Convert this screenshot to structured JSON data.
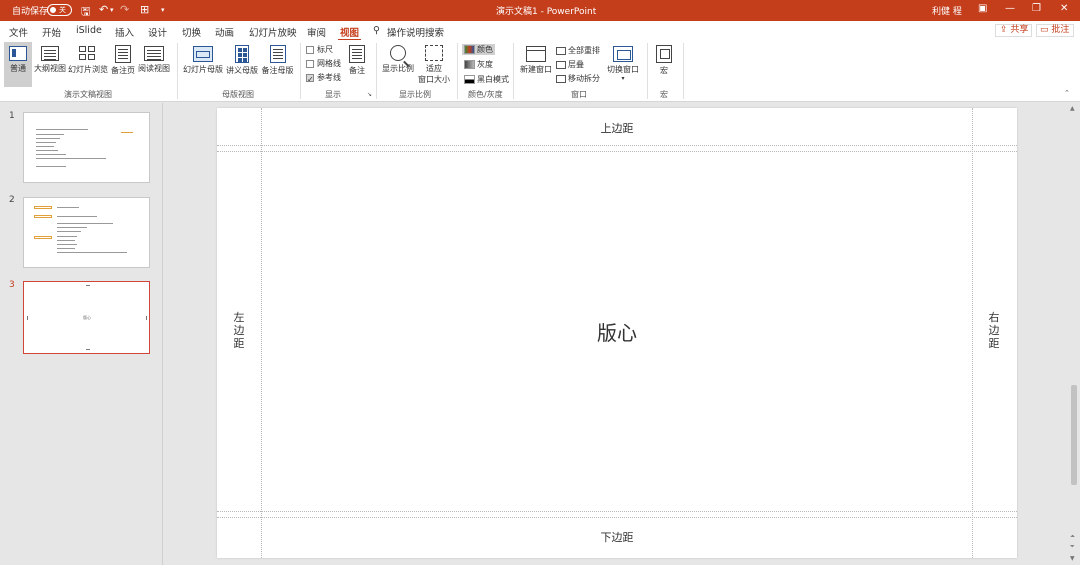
{
  "titlebar": {
    "autosave_label": "自动保存",
    "autosave_state": "关",
    "doc_title": "演示文稿1 - PowerPoint",
    "user": "利健 程",
    "color": "#c43e1c"
  },
  "menu": {
    "tabs": [
      "文件",
      "开始",
      "iSlide",
      "插入",
      "设计",
      "切换",
      "动画",
      "幻灯片放映",
      "审阅",
      "视图"
    ],
    "active_tab": "视图",
    "search_label": "操作说明搜索",
    "share_label": "共享",
    "comments_label": "批注"
  },
  "ribbon": {
    "groups": {
      "presentation_views": {
        "label": "演示文稿视图",
        "buttons": [
          "普通",
          "大纲视图",
          "幻灯片浏览",
          "备注页",
          "阅读视图"
        ]
      },
      "master_views": {
        "label": "母版视图",
        "buttons": [
          "幻灯片母版",
          "讲义母版",
          "备注母版"
        ]
      },
      "show": {
        "label": "显示",
        "checkboxes": [
          {
            "label": "标尺",
            "checked": false
          },
          {
            "label": "网格线",
            "checked": false
          },
          {
            "label": "参考线",
            "checked": true
          }
        ],
        "notes_button": "备注"
      },
      "zoom": {
        "label": "显示比例",
        "zoom_button": "显示比例",
        "fit_button_line1": "适应",
        "fit_button_line2": "窗口大小"
      },
      "color": {
        "label": "颜色/灰度",
        "options": [
          "颜色",
          "灰度",
          "黑白模式"
        ]
      },
      "window": {
        "label": "窗口",
        "new_window": "新建窗口",
        "arrange_all": "全部重排",
        "cascade": "层叠",
        "move_split": "移动拆分",
        "switch_window": "切换窗口"
      },
      "macros": {
        "label": "宏",
        "macro_button": "宏"
      }
    }
  },
  "thumbnails": {
    "numbers": [
      "1",
      "2",
      "3"
    ],
    "selected": "3",
    "slide3_center": "版心"
  },
  "slide": {
    "top_margin": "上边距",
    "bottom_margin": "下边距",
    "left_margin": "左\n边\n距",
    "right_margin": "右\n边\n距",
    "center": "版心"
  }
}
